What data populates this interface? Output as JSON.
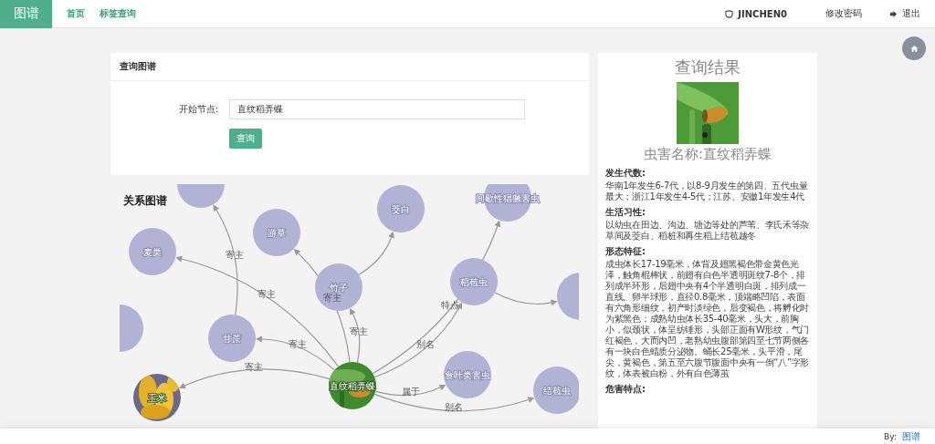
{
  "nav": {
    "brand": "图谱",
    "links": [
      {
        "label": "首页"
      },
      {
        "label": "标签查询"
      }
    ],
    "user": "JINCHEN0",
    "change_password": "修改密码",
    "logout": "退出"
  },
  "query_card": {
    "title": "查询图谱",
    "field_label": "开始节点:",
    "field_value": "直纹稻弄蝶",
    "button": "查询"
  },
  "graph": {
    "title": "关系图谱",
    "nodes": [
      {
        "kind": "plain"
      },
      {
        "kind": "plain",
        "label": "麦类"
      },
      {
        "kind": "plain",
        "label": "游草"
      },
      {
        "kind": "plain",
        "label": "茭白"
      },
      {
        "kind": "plain",
        "label": "间歇性猖獗害虫"
      },
      {
        "kind": "plain",
        "label": "竹子"
      },
      {
        "kind": "plain",
        "label": "稻苞虫"
      },
      {
        "kind": "plain"
      },
      {
        "kind": "plain",
        "label": "甘蔗"
      },
      {
        "kind": "plain"
      },
      {
        "kind": "picture",
        "label": "直纹稻弄蝶"
      },
      {
        "kind": "plain",
        "label": "食叶类害虫"
      },
      {
        "kind": "plain",
        "label": "结苞虫"
      },
      {
        "kind": "picture",
        "label": "玉米"
      }
    ],
    "edge_labels": [
      {
        "label": "寄主"
      },
      {
        "label": "寄主"
      },
      {
        "label": "寄主"
      },
      {
        "label": "寄主"
      },
      {
        "label": "寄主"
      },
      {
        "label": "别名"
      },
      {
        "label": "特点"
      },
      {
        "label": "属于"
      },
      {
        "label": "别名"
      },
      {
        "label": "寄主"
      }
    ]
  },
  "result": {
    "title": "查询结果",
    "name": "虫害名称:直纹稻弄蝶",
    "sections": [
      {
        "heading": "发生代数:",
        "text": "华南1年发生6-7代，以8-9月发生的第四、五代虫量最大；浙江1年发生4-5代；江苏、安徽1年发生4代"
      },
      {
        "heading": "生活习性:",
        "text": "以幼虫在田边、沟边、塘边等处的芦苇、李氏禾等杂草间及茭白、稻桩和再生稻上结苞越冬"
      },
      {
        "heading": "形态特征:",
        "text": "成虫体长17-19毫米，体背及翅黑褐色带金黄色光泽，触角棍棒状，前翅有白色半透明斑纹7-8个，排列成半环形，后翅中央有4个半透明白斑，排列成一直线。卵半球形，直径0.8毫米，顶端略凹陷，表面有六角形细纹，初产时淡绿色，后变褐色，将孵化时为紫黑色；成熟幼虫体长35-40毫米，头大，前胸小，似颈状，体呈纺锤形，头部正面有W形纹，气门红褐色，大而内凹，老熟幼虫腹部第四至七节两侧各有一块白色蜡质分泌物。蛹长25毫米，头平滑，尾尖，黄褐色，第五至六腹节腹面中央有一倒“八”字形纹，体表被白粉，外有白色薄茧"
      },
      {
        "heading": "危害特点:"
      }
    ]
  },
  "footer": {
    "by": "By:",
    "link": "图谱"
  }
}
